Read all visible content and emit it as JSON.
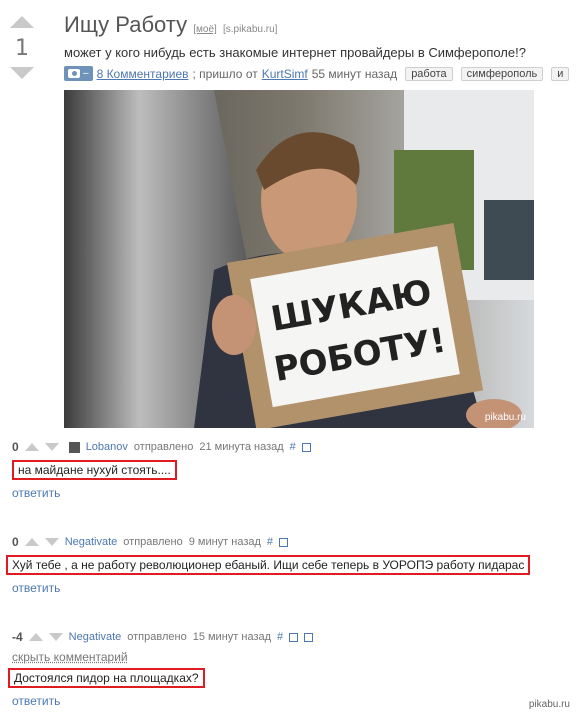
{
  "post": {
    "rating": "1",
    "title": "Ищу Работу",
    "mine_label": "[моё]",
    "source": "[s.pikabu.ru]",
    "description": "может у кого нибудь есть знакомые интернет провайдеры в Симферополе!?",
    "media_badge": "–",
    "comments_link": "8 Комментариев",
    "posted_prefix": "; пришло от",
    "author": "KurtSimf",
    "posted_time": "55 минут назад",
    "tags": [
      "работа",
      "симферополь",
      "и"
    ]
  },
  "photo": {
    "sign_line1": "ШУКАЮ",
    "sign_line2": "РОБОТУ!",
    "watermark": "pikabu.ru"
  },
  "comments": [
    {
      "score": "0",
      "user": "Lobanov",
      "sent": "отправлено",
      "time": "21 минута назад",
      "hash": "#",
      "text": "на майдане нухуй стоять....",
      "reply": "ответить"
    },
    {
      "score": "0",
      "user": "Negativate",
      "sent": "отправлено",
      "time": "9 минут назад",
      "hash": "#",
      "text": "Хуй тебе , а не работу революционер ебаный. Ищи себе теперь в УОРОПЭ работу пидарас",
      "reply": "ответить"
    },
    {
      "score": "-4",
      "user": "Negativate",
      "sent": "отправлено",
      "time": "15 минут назад",
      "hash": "#",
      "hide": "скрыть комментарий",
      "text": "Достоялся пидор на площадках?",
      "reply": "ответить"
    }
  ],
  "watermark": "pikabu.ru",
  "colors": {
    "accent_link": "#4d77b0",
    "highlight_border": "#e01b22",
    "vote_arrow": "#c9c9c9"
  }
}
